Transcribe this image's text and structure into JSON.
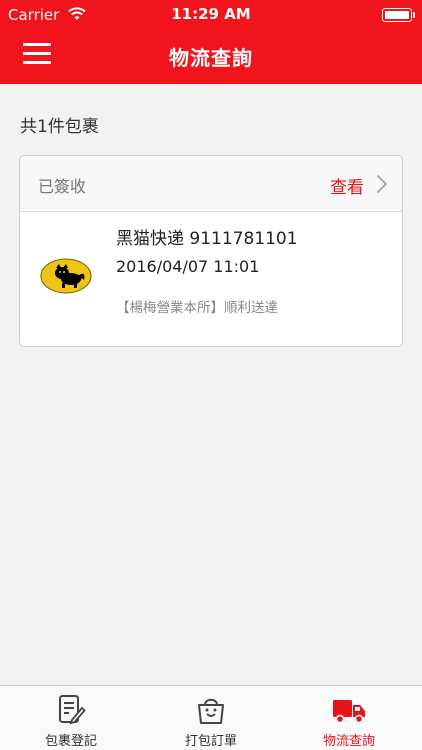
{
  "status_bar": {
    "carrier": "Carrier",
    "time": "11:29 AM"
  },
  "navbar": {
    "title": "物流查詢",
    "menu_icon": "hamburger-menu-icon"
  },
  "summary": {
    "count_text": "共1件包裹"
  },
  "package": {
    "status": "已簽收",
    "view_label": "查看",
    "courier_line": "黑猫快递 9111781101",
    "datetime": "2016/04/07 11:01",
    "location_line": "【楊梅營業本所】順利送達",
    "logo_icon": "black-cat-logo-icon"
  },
  "tabs": [
    {
      "label": "包裹登記",
      "icon": "register-form-icon",
      "active": false
    },
    {
      "label": "打包訂單",
      "icon": "shopping-bag-icon",
      "active": false
    },
    {
      "label": "物流查詢",
      "icon": "delivery-truck-icon",
      "active": true
    }
  ],
  "colors": {
    "accent": "#f1141c",
    "active_tab": "#e4141b"
  }
}
